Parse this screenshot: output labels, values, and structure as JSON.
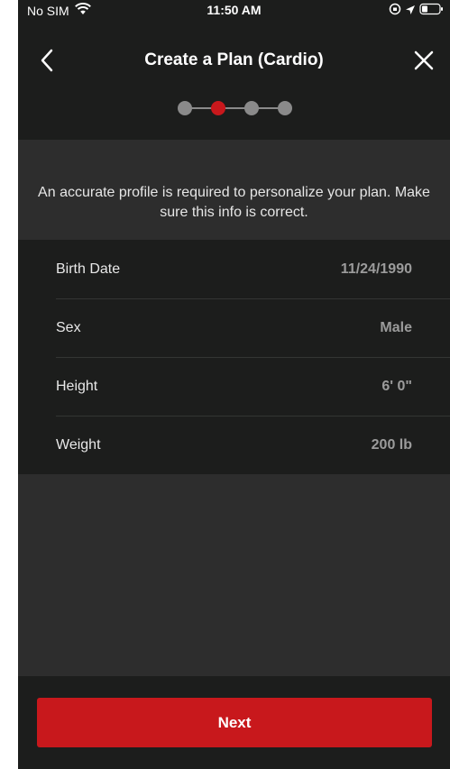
{
  "status_bar": {
    "carrier": "No SIM",
    "time": "11:50 AM"
  },
  "header": {
    "title": "Create a Plan (Cardio)",
    "steps_total": 4,
    "current_step": 2,
    "active_color": "#c8181c",
    "inactive_color": "#8a8a8a"
  },
  "info": {
    "message": "An accurate profile is required to personalize your plan. Make sure this info is correct."
  },
  "profile": {
    "rows": [
      {
        "label": "Birth Date",
        "value": "11/24/1990"
      },
      {
        "label": "Sex",
        "value": "Male"
      },
      {
        "label": "Height",
        "value": "6' 0\""
      },
      {
        "label": "Weight",
        "value": "200 lb"
      }
    ]
  },
  "footer": {
    "next_label": "Next",
    "button_color": "#c8181c"
  }
}
